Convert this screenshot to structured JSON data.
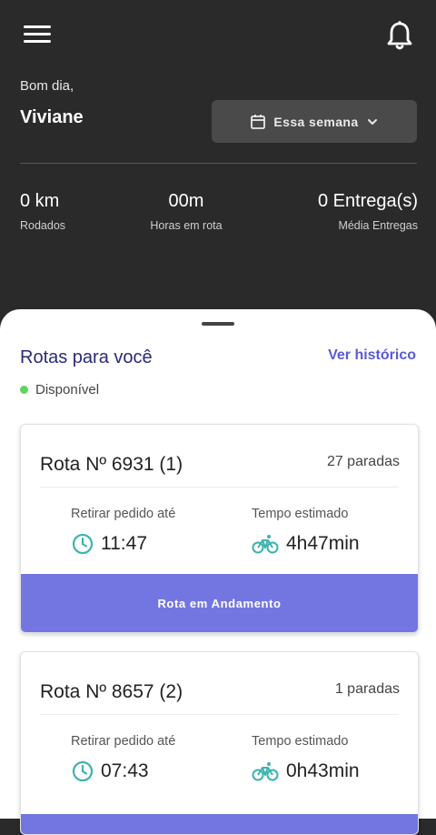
{
  "header": {
    "greeting": "Bom dia,",
    "user_name": "Viviane",
    "period_label": "Essa semana",
    "icons": {
      "menu": "hamburger-menu-icon",
      "notifications": "bell-icon",
      "calendar": "calendar-icon",
      "dropdown": "chevron-down-icon"
    }
  },
  "stats": [
    {
      "value": "0 km",
      "label": "Rodados"
    },
    {
      "value": "00m",
      "label": "Horas em rota"
    },
    {
      "value": "0 Entrega(s)",
      "label": "Média Entregas"
    }
  ],
  "routes_section": {
    "title": "Rotas para você",
    "history_link": "Ver histórico",
    "status_text": "Disponível",
    "status_color": "#5cd65c"
  },
  "routes": [
    {
      "title": "Rota Nº 6931 (1)",
      "stops": "27 paradas",
      "pickup_label": "Retirar pedido até",
      "pickup_time": "11:47",
      "estimate_label": "Tempo estimado",
      "estimate_time": "4h47min",
      "action_label": "Rota em Andamento"
    },
    {
      "title": "Rota Nº 8657 (2)",
      "stops": "1 paradas",
      "pickup_label": "Retirar pedido até",
      "pickup_time": "07:43",
      "estimate_label": "Tempo estimado",
      "estimate_time": "0h43min",
      "action_label": ""
    }
  ],
  "colors": {
    "background_dark": "#2a2a2a",
    "accent": "#7376e0",
    "icon_teal": "#3bb3b0",
    "title_navy": "#2a2a7a"
  }
}
